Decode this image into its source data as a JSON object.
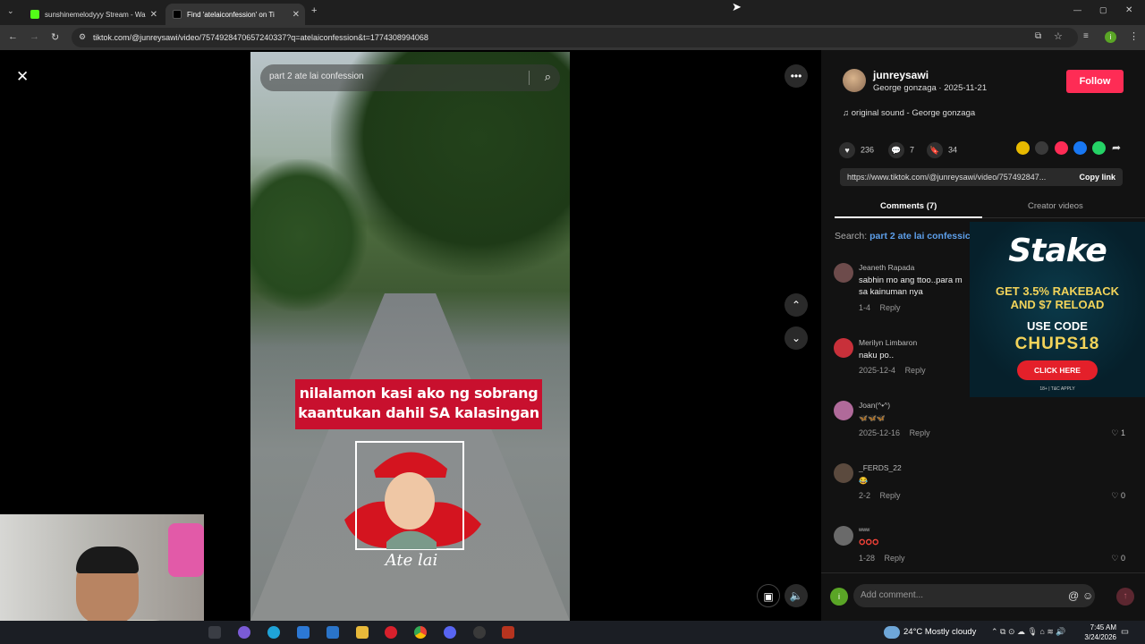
{
  "browser": {
    "tabs": [
      {
        "title": "sunshinemelodyyy Stream - Wa",
        "active": false,
        "favicon_color": "#53fc18"
      },
      {
        "title": "Find 'atelaiconfession' on Ti",
        "active": true,
        "favicon_color": "#111111"
      }
    ],
    "url": "tiktok.com/@junreysawi/video/7574928470657240337?q=atelaiconfession&t=1774308994068",
    "profile_initial": "i"
  },
  "video": {
    "search_text": "part 2 ate lai confession",
    "caption_line1": "nilalamon kasi ako ng sobrang",
    "caption_line2": "kaantukan dahil SA kalasingan",
    "sticker_text": "Ate lai"
  },
  "post": {
    "username": "junreysawi",
    "subline": "George gonzaga · 2025-11-21",
    "follow_label": "Follow",
    "music": "original sound - George gonzaga",
    "likes": "236",
    "comments": "7",
    "saves": "34",
    "share_link": "https://www.tiktok.com/@junreysawi/video/757492847...",
    "copy_label": "Copy link"
  },
  "panel_tabs": {
    "comments": "Comments (7)",
    "creator": "Creator videos"
  },
  "search_line": {
    "prefix": "Search:",
    "query": "part 2 ate lai confessic"
  },
  "comments": [
    {
      "name": "Jeaneth Rapada",
      "text": "sabhin mo ang ttoo..para m sa kainuman nya",
      "date": "1-4",
      "reply": "Reply",
      "likes": "",
      "avatar_color": "#6d4b4b"
    },
    {
      "name": "Merilyn Limbaron",
      "text": "naku po..",
      "date": "2025-12-4",
      "reply": "Reply",
      "likes": "",
      "avatar_color": "#c8303a"
    },
    {
      "name": "Joan(^•^)",
      "text": "🦋🦋🦋",
      "date": "2025-12-16",
      "reply": "Reply",
      "likes": "1",
      "avatar_color": "#b06a9a"
    },
    {
      "name": "_FERDS_22",
      "text": "😂",
      "date": "2-2",
      "reply": "Reply",
      "likes": "0",
      "avatar_color": "#5b4a3e"
    },
    {
      "name": "ʷʷʷ",
      "text": "⭕⭕⭕",
      "date": "1-28",
      "reply": "Reply",
      "likes": "0",
      "avatar_color": "#6a6a6a"
    }
  ],
  "ad": {
    "logo": "Stake",
    "line1": "GET 3.5% RAKEBACK",
    "line1b": "AND $7 RELOAD",
    "line2": "USE CODE",
    "code": "CHUPS18",
    "button": "CLICK HERE",
    "fine": "18+ | T&C APPLY"
  },
  "composer": {
    "placeholder": "Add comment...",
    "initial": "i"
  },
  "taskbar": {
    "weather": "24°C  Mostly cloudy",
    "time": "7:45 AM",
    "date": "3/24/2026"
  },
  "colors": {
    "accent": "#fe2c55",
    "link": "#5d9fea",
    "panel_bg": "#121212"
  }
}
